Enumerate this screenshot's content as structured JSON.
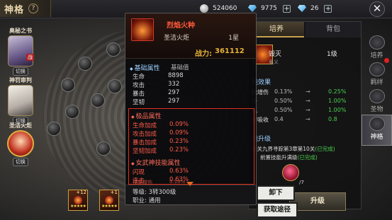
{
  "header": {
    "title": "神格",
    "currency": [
      {
        "icon": "silver-coin-icon",
        "value": "524060"
      },
      {
        "icon": "diamond-icon",
        "value": "9775"
      },
      {
        "icon": "blue-diamond-icon",
        "value": "26"
      }
    ]
  },
  "characters": [
    {
      "name": "奥秘之书",
      "switch": "切换",
      "badge": "战"
    },
    {
      "name": "神罚审判",
      "switch": "切换"
    },
    {
      "name": "圣洁火炬",
      "switch": "切换"
    }
  ],
  "slots": [
    {
      "level": "+12",
      "stars": "★★★★★"
    },
    {
      "level": "+1",
      "stars": "★★★★★"
    }
  ],
  "tooltip": {
    "name": "烈焰火种",
    "subtitle": "圣洁火炬",
    "star": "1星",
    "power_label": "战力:",
    "power_value": "361112",
    "base_title": "基础属性",
    "base_header": "基础值",
    "base_stats": [
      {
        "k": "生命",
        "v": "8898"
      },
      {
        "k": "攻击",
        "v": "332"
      },
      {
        "k": "暴击",
        "v": "297"
      },
      {
        "k": "坚韧",
        "v": "297"
      }
    ],
    "top_title": "极品属性",
    "top_stats": [
      {
        "k": "生命加成",
        "v": "0.09%"
      },
      {
        "k": "攻击加成",
        "v": "0.09%"
      },
      {
        "k": "暴击加成",
        "v": "0.23%"
      },
      {
        "k": "坚韧加成",
        "v": "0.23%"
      }
    ],
    "skill_title": "女武神技能属性",
    "skill_stats": [
      {
        "k": "闪现",
        "v": "0.63%"
      },
      {
        "k": "连击",
        "v": "0.63%"
      },
      {
        "k": "技能增伤",
        "v": "0.16%"
      }
    ],
    "level_label": "等级:",
    "level_value": "3转300级",
    "job_label": "职业:",
    "job_value": "通用"
  },
  "right_panel": {
    "tabs": [
      "培养",
      "背包"
    ],
    "skill_name": "毁灭",
    "skill_sub": "奥义",
    "skill_level": "1级",
    "effect_title": "能效果",
    "effects": [
      {
        "a": "能增伤",
        "b": "0.13%",
        "c": "0.25%"
      },
      {
        "a": "击",
        "b": "0.50%",
        "c": "1.00%"
      },
      {
        "a": "现",
        "b": "0.50%",
        "c": "1.00%"
      },
      {
        "a": "害吸收",
        "b": "0.4",
        "c": "0.8"
      }
    ],
    "upgrade_title": "能升级",
    "req1_prefix": "通关九界寻踪第3章第10关",
    "req1_status": "(已完成)",
    "req2_prefix": "前置技能升满级",
    "req2_status": "(已完成)",
    "material_count": "/7",
    "upgrade_button": "升级"
  },
  "actions": {
    "unload": "卸下",
    "obtain": "获取途径"
  },
  "side_tabs": [
    "培养",
    "羁绊",
    "圣物",
    "神格"
  ]
}
